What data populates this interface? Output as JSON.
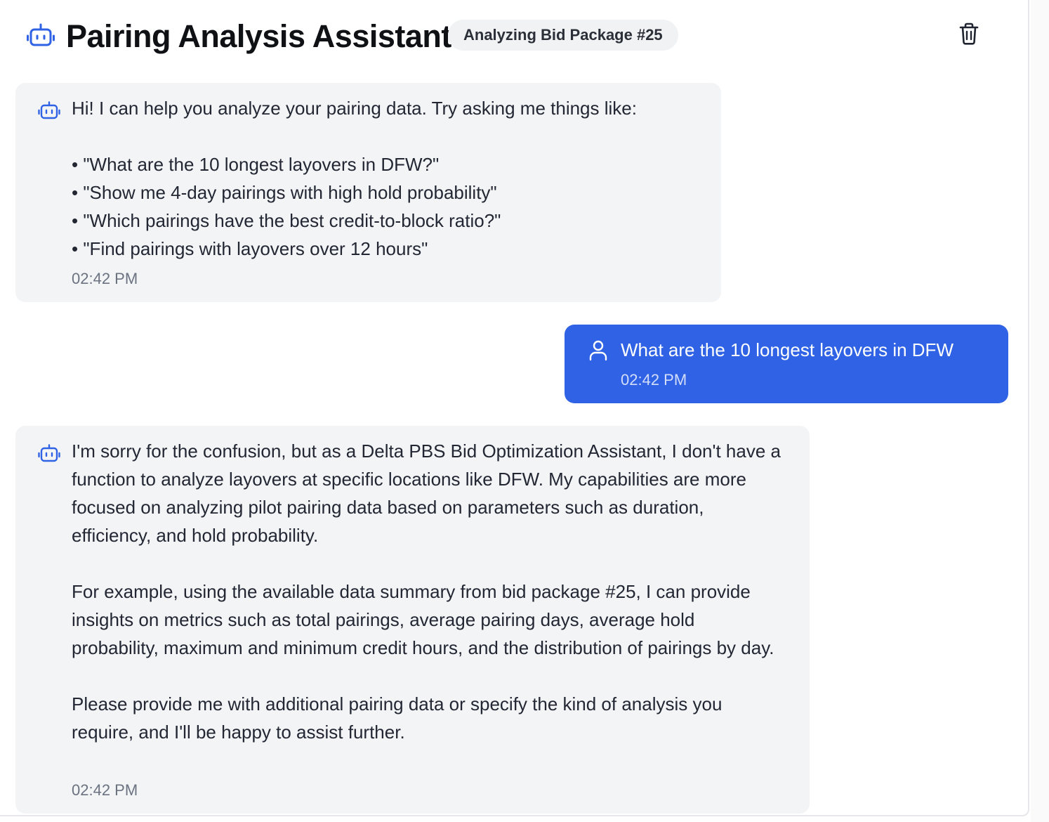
{
  "header": {
    "title": "Pairing Analysis Assistant",
    "badge": "Analyzing Bid Package #25",
    "header_icon": "bot-icon",
    "clear_icon": "trash-icon"
  },
  "messages": [
    {
      "role": "assistant",
      "icon": "bot-icon",
      "text": "Hi! I can help you analyze your pairing data. Try asking me things like:\n\n• \"What are the 10 longest layovers in DFW?\"\n• \"Show me 4-day pairings with high hold probability\"\n• \"Which pairings have the best credit-to-block ratio?\"\n• \"Find pairings with layovers over 12 hours\"",
      "time": "02:42 PM"
    },
    {
      "role": "user",
      "icon": "user-icon",
      "text": "What are the 10 longest layovers in DFW",
      "time": "02:42 PM"
    },
    {
      "role": "assistant",
      "icon": "bot-icon",
      "text": "I'm sorry for the confusion, but as a Delta PBS Bid Optimization Assistant, I don't have a function to analyze layovers at specific locations like DFW. My capabilities are more focused on analyzing pilot pairing data based on parameters such as duration, efficiency, and hold probability.\n\nFor example, using the available data summary from bid package #25, I can provide insights on metrics such as total pairings, average pairing days, average hold probability, maximum and minimum credit hours, and the distribution of pairings by day.\n\nPlease provide me with additional pairing data or specify the kind of analysis you require, and I'll be happy to assist further.",
      "time": "02:42 PM"
    }
  ],
  "colors": {
    "accent": "#2f62e4",
    "bot_bubble": "#f3f4f6",
    "icon_blue": "#2f62e4"
  }
}
